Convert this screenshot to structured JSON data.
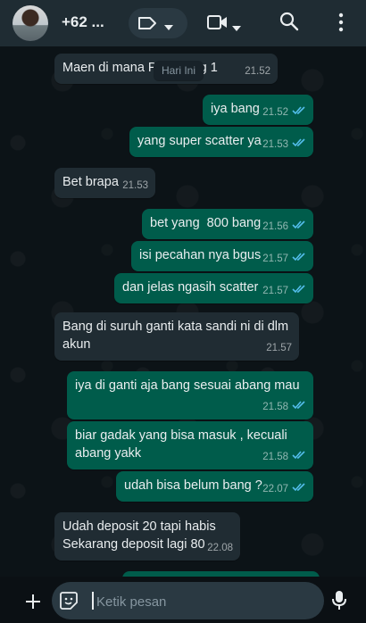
{
  "header": {
    "contact_name": "+62 ...",
    "icons": [
      "label-icon",
      "chevron-down-icon",
      "video-call-icon",
      "search-icon",
      "more-options-icon"
    ]
  },
  "date_chip": "Hari Ini",
  "messages": [
    {
      "dir": "in",
      "text": "Maen di mana P        ong 1",
      "time": "21.52",
      "read": false
    },
    {
      "dir": "out",
      "text": "iya bang",
      "time": "21.52",
      "read": true
    },
    {
      "dir": "out",
      "text": "yang super scatter ya",
      "time": "21.53",
      "read": true
    },
    {
      "dir": "in",
      "text": "Bet brapa",
      "time": "21.53",
      "read": false
    },
    {
      "dir": "out",
      "text": "bet yang  800 bang",
      "time": "21.56",
      "read": true
    },
    {
      "dir": "out",
      "text": "isi pecahan nya bgus",
      "time": "21.57",
      "read": true
    },
    {
      "dir": "out",
      "text": "dan jelas ngasih scatter",
      "time": "21.57",
      "read": true
    },
    {
      "dir": "in",
      "text": "Bang di suruh ganti kata sandi ni di dlm akun",
      "time": "21.57",
      "read": false
    },
    {
      "dir": "out",
      "text": "iya di ganti aja bang sesuai abang mau",
      "time": "21.58",
      "read": true
    },
    {
      "dir": "out",
      "text": "biar gadak yang bisa masuk , kecuali abang yakk",
      "time": "21.58",
      "read": true
    },
    {
      "dir": "out",
      "text": "udah bisa belum bang ?",
      "time": "22.07",
      "read": true
    },
    {
      "dir": "in",
      "text": "Udah deposit 20 tapi habis\nSekarang deposit lagi 80",
      "time": "22.08",
      "read": false
    }
  ],
  "composer": {
    "placeholder": "Ketik pesan",
    "value": "",
    "icons": [
      "plus-icon",
      "sticker-icon",
      "microphone-icon"
    ]
  },
  "colors": {
    "header_bg": "#1f2c33",
    "incoming_bubble": "#202c33",
    "outgoing_bubble": "#005c4b",
    "read_check": "#53bdeb",
    "text": "#e9edef"
  }
}
